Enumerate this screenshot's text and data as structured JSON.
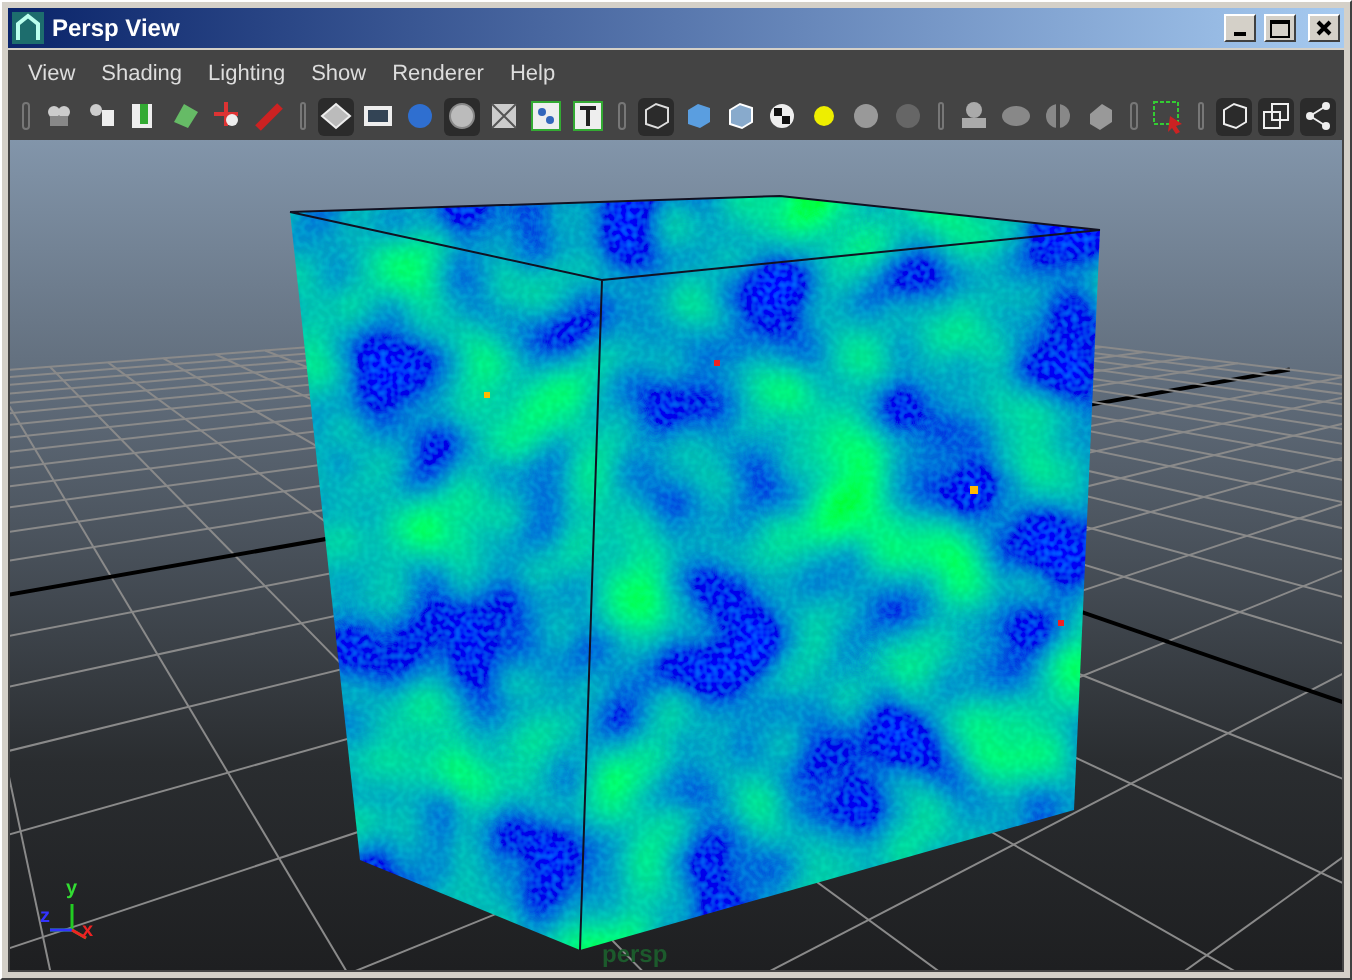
{
  "window": {
    "title": "Persp View"
  },
  "menu": [
    "View",
    "Shading",
    "Lighting",
    "Show",
    "Renderer",
    "Help"
  ],
  "toolbar": [
    [
      {
        "pressed": false
      },
      {
        "pressed": false
      },
      {
        "pressed": false
      },
      {
        "pressed": false
      },
      {
        "pressed": false
      },
      {
        "pressed": false
      }
    ],
    [
      {
        "pressed": true
      },
      {
        "pressed": false
      },
      {
        "pressed": false
      },
      {
        "pressed": true
      },
      {
        "pressed": false
      },
      {
        "pressed": false
      },
      {
        "pressed": false
      }
    ],
    [
      {
        "pressed": true
      },
      {
        "pressed": false
      },
      {
        "pressed": false
      },
      {
        "pressed": false
      },
      {
        "pressed": false
      },
      {
        "pressed": false
      },
      {
        "pressed": false
      }
    ],
    [
      {
        "pressed": false
      },
      {
        "pressed": false
      },
      {
        "pressed": false
      },
      {
        "pressed": false
      }
    ],
    [
      {
        "pressed": false
      }
    ],
    [
      {
        "pressed": true
      },
      {
        "pressed": true
      },
      {
        "pressed": true
      }
    ]
  ],
  "viewport": {
    "axes": [
      {
        "label": "y"
      },
      {
        "label": "z"
      },
      {
        "label": "x"
      }
    ],
    "camera_label": "persp"
  }
}
